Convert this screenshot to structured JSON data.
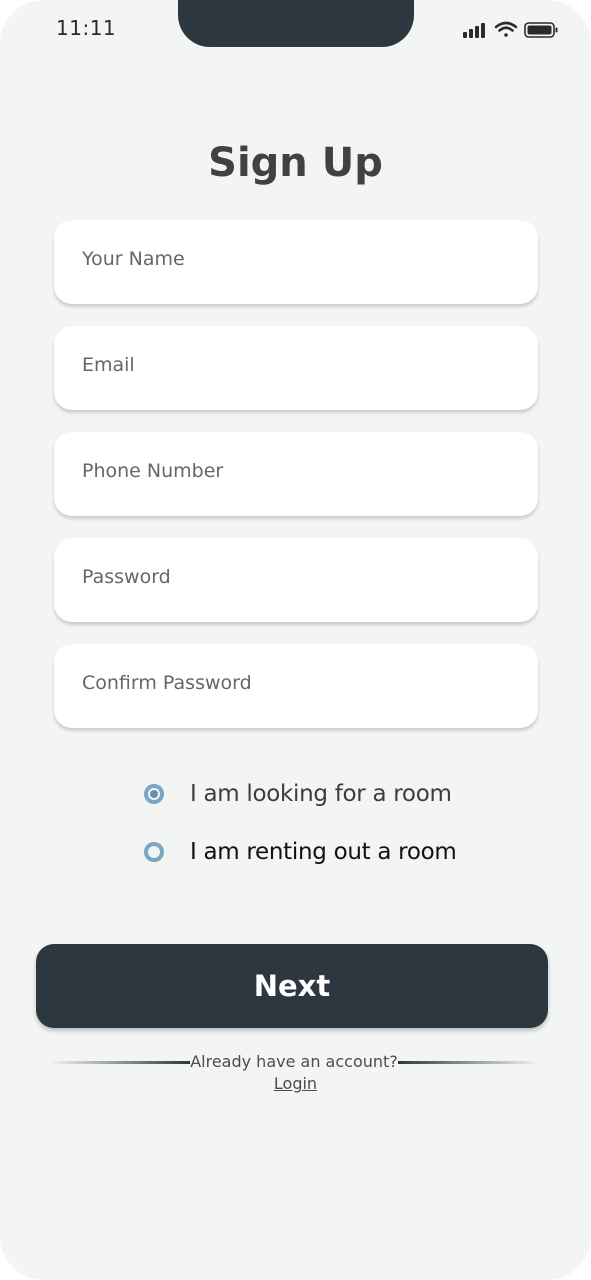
{
  "status_bar": {
    "time": "11:11",
    "icons": [
      "signal-icon",
      "wifi-icon",
      "battery-icon"
    ]
  },
  "title": "Sign Up",
  "form": {
    "fields": [
      {
        "placeholder": "Your Name",
        "value": ""
      },
      {
        "placeholder": "Email",
        "value": ""
      },
      {
        "placeholder": "Phone Number",
        "value": ""
      },
      {
        "placeholder": "Password",
        "value": ""
      },
      {
        "placeholder": "Confirm Password",
        "value": ""
      }
    ],
    "options": [
      {
        "label": "I am looking for a room",
        "selected": true
      },
      {
        "label": "I am renting out a room",
        "selected": false
      }
    ]
  },
  "next_button": "Next",
  "footer": {
    "prompt": "Already have an account?",
    "login": "Login"
  },
  "colors": {
    "background": "#f3f4f4",
    "primary": "#2c3740",
    "radio_accent": "#7aa6c4",
    "field_background": "#ffffff"
  }
}
